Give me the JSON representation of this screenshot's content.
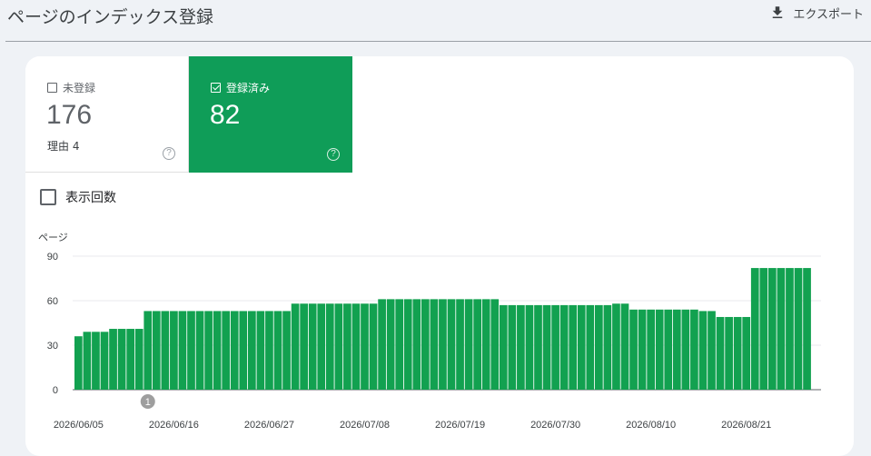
{
  "header": {
    "title": "ページのインデックス登録",
    "export_label": "エクスポート"
  },
  "metrics": {
    "unregistered": {
      "label": "未登録",
      "value": "176",
      "sub": "理由 4",
      "help": "?"
    },
    "registered": {
      "label": "登録済み",
      "value": "82",
      "help": "?"
    }
  },
  "toggles": {
    "impressions_label": "表示回数"
  },
  "colors": {
    "accent": "#0f9d58",
    "bar": "#12a150"
  },
  "chart_data": {
    "type": "bar",
    "ylabel": "ページ",
    "yticks": [
      0,
      30,
      60,
      90
    ],
    "ylim": [
      0,
      90
    ],
    "x_tick_labels": [
      "2026/06/05",
      "2026/06/16",
      "2026/06/27",
      "2026/07/08",
      "2026/07/19",
      "2026/07/30",
      "2026/08/10",
      "2026/08/21"
    ],
    "start_date": "2026/06/05",
    "values": [
      36,
      39,
      39,
      39,
      41,
      41,
      41,
      41,
      53,
      53,
      53,
      53,
      53,
      53,
      53,
      53,
      53,
      53,
      53,
      53,
      53,
      53,
      53,
      53,
      53,
      58,
      58,
      58,
      58,
      58,
      58,
      58,
      58,
      58,
      58,
      61,
      61,
      61,
      61,
      61,
      61,
      61,
      61,
      61,
      61,
      61,
      61,
      61,
      61,
      57,
      57,
      57,
      57,
      57,
      57,
      57,
      57,
      57,
      57,
      57,
      57,
      57,
      58,
      58,
      54,
      54,
      54,
      54,
      54,
      54,
      54,
      54,
      53,
      53,
      49,
      49,
      49,
      49,
      82,
      82,
      82,
      82,
      82,
      82,
      82
    ],
    "annotations": [
      {
        "date": "2026/06/13",
        "label": "1"
      }
    ]
  }
}
